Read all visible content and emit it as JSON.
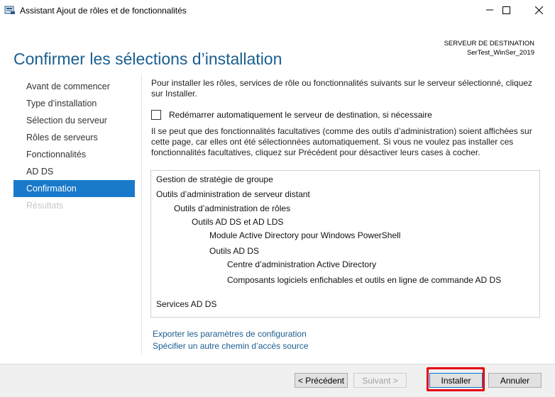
{
  "window": {
    "title": "Assistant Ajout de rôles et de fonctionnalités",
    "minimize_icon": "minimize-icon",
    "maximize_icon": "maximize-icon",
    "close_icon": "close-icon"
  },
  "header": {
    "title": "Confirmer les sélections d’installation",
    "destination_label": "SERVEUR DE DESTINATION",
    "destination_server": "SerTest_WinSer_2019"
  },
  "sidebar": {
    "items": [
      {
        "label": "Avant de commencer",
        "state": "normal"
      },
      {
        "label": "Type d’installation",
        "state": "normal"
      },
      {
        "label": "Sélection du serveur",
        "state": "normal"
      },
      {
        "label": "Rôles de serveurs",
        "state": "normal"
      },
      {
        "label": "Fonctionnalités",
        "state": "normal"
      },
      {
        "label": "AD DS",
        "state": "normal"
      },
      {
        "label": "Confirmation",
        "state": "active"
      },
      {
        "label": "Résultats",
        "state": "disabled"
      }
    ]
  },
  "main": {
    "intro": "Pour installer les rôles, services de rôle ou fonctionnalités suivants sur le serveur sélectionné, cliquez sur Installer.",
    "restart_checkbox": {
      "label": "Redémarrer automatiquement le serveur de destination, si nécessaire",
      "checked": false
    },
    "note": "Il se peut que des fonctionnalités facultatives (comme des outils d’administration) soient affichées sur cette page, car elles ont été sélectionnées automatiquement. Si vous ne voulez pas installer ces fonctionnalités facultatives, cliquez sur Précédent pour désactiver leurs cases à cocher.",
    "features": [
      {
        "label": "Gestion de stratégie de groupe",
        "level": 0
      },
      {
        "label": "Outils d’administration de serveur distant",
        "level": 0
      },
      {
        "label": "Outils d’administration de rôles",
        "level": 1
      },
      {
        "label": "Outils AD DS et AD LDS",
        "level": 2
      },
      {
        "label": "Module Active Directory pour Windows PowerShell",
        "level": 3
      },
      {
        "label": "Outils AD DS",
        "level": 3
      },
      {
        "label": "Centre d’administration Active Directory",
        "level": 4
      },
      {
        "label": "Composants logiciels enfichables et outils en ligne de commande AD DS",
        "level": 4
      },
      {
        "label": "Services AD DS",
        "level": 0
      }
    ],
    "links": {
      "export": "Exporter les paramètres de configuration",
      "alt_source": "Spécifier un autre chemin d’accès source"
    }
  },
  "footer": {
    "previous": "< Précédent",
    "next": "Suivant >",
    "install": "Installer",
    "cancel": "Annuler"
  },
  "colors": {
    "accent": "#1979ca",
    "title": "#1a5e8f",
    "highlight": "#e8000a"
  }
}
